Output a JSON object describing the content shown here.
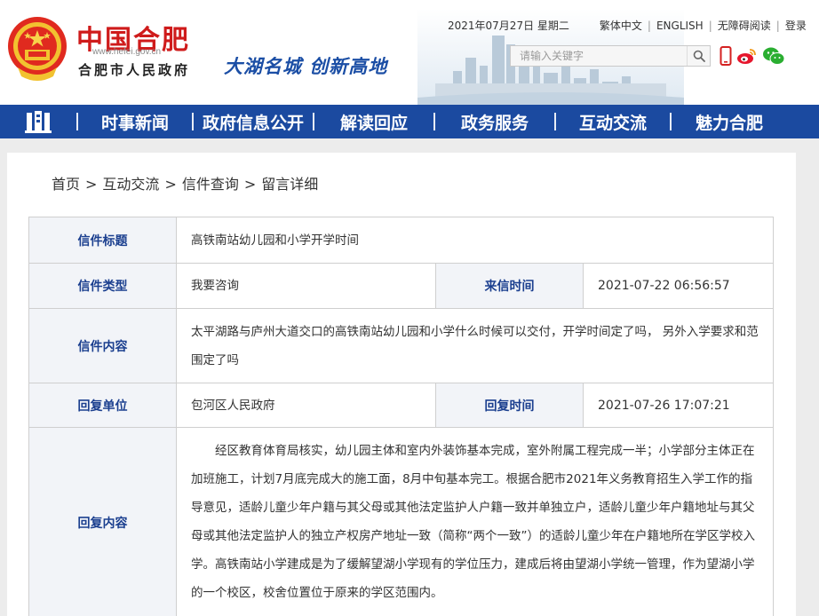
{
  "header": {
    "site_name": "中国合肥",
    "domain": "www.hefei.gov.cn",
    "sub_name": "合肥市人民政府",
    "slogan": "大湖名城  创新高地",
    "date": "2021年07月27日 星期二",
    "links": {
      "traditional": "繁体中文",
      "english": "ENGLISH",
      "accessible": "无障碍阅读",
      "login": "登录"
    },
    "separator": "|",
    "search_placeholder": "请输入关键字",
    "icons": {
      "search": "search-icon",
      "mobile": "mobile-icon",
      "weibo": "weibo-icon",
      "wechat": "wechat-icon"
    }
  },
  "nav": {
    "items": [
      "时事新闻",
      "政府信息公开",
      "解读回应",
      "政务服务",
      "互动交流",
      "魅力合肥"
    ]
  },
  "breadcrumb": {
    "items": [
      "首页",
      "互动交流",
      "信件查询",
      "留言详细"
    ],
    "sep": ">"
  },
  "letter": {
    "title_label": "信件标题",
    "title": "高铁南站幼儿园和小学开学时间",
    "type_label": "信件类型",
    "type": "我要咨询",
    "time_label": "来信时间",
    "time": "2021-07-22 06:56:57",
    "content_label": "信件内容",
    "content": "太平湖路与庐州大道交口的高铁南站幼儿园和小学什么时候可以交付，开学时间定了吗， 另外入学要求和范围定了吗",
    "unit_label": "回复单位",
    "unit": "包河区人民政府",
    "reply_time_label": "回复时间",
    "reply_time": "2021-07-26 17:07:21",
    "reply_label": "回复内容",
    "reply": "经区教育体育局核实，幼儿园主体和室内外装饰基本完成，室外附属工程完成一半；小学部分主体正在加班施工，计划7月底完成大的施工面，8月中旬基本完工。根据合肥市2021年义务教育招生入学工作的指导意见，适龄儿童少年户籍与其父母或其他法定监护人户籍一致并单独立户，适龄儿童少年户籍地址与其父母或其他法定监护人的独立产权房产地址一致（简称“两个一致”）的适龄儿童少年在户籍地所在学区学校入学。高铁南站小学建成是为了缓解望湖小学现有的学位压力，建成后将由望湖小学统一管理，作为望湖小学的一个校区，校舍位置位于原来的学区范围内。"
  },
  "colors": {
    "nav_bg": "#1b4aa0",
    "brand_red": "#cf1b1b",
    "label_blue": "#1b3f8f",
    "label_bg": "#f2f4f8"
  }
}
